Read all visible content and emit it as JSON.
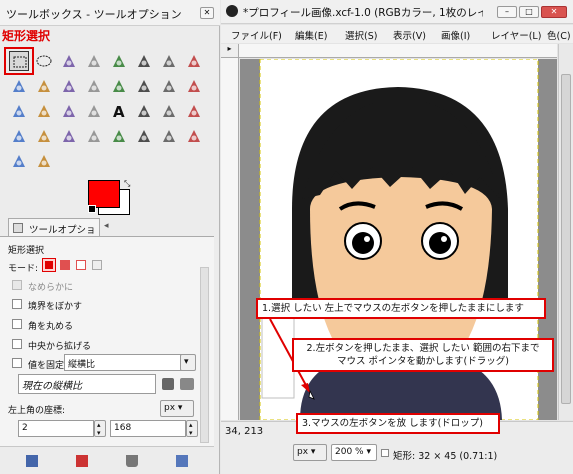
{
  "toolbox": {
    "title": "ツールボックス - ツールオプション",
    "rect_select_label": "矩形選択",
    "options_tab": "ツールオプション",
    "options_title": "矩形選択",
    "mode_label": "モード:",
    "antialias": "なめらかに",
    "feather": "境界をぼかす",
    "rounded": "角を丸める",
    "expand_center": "中央から拡げる",
    "fixed": "値を固定",
    "fixed_value": "縦横比",
    "ratio_field": "現在の縦横比",
    "position_label": "左上角の座標:",
    "unit": "px",
    "x_value": "2",
    "y_value": "168"
  },
  "image_window": {
    "title": "*プロフィール画像.xcf-1.0 (RGBカラー, 1枚のレイ…",
    "menus": [
      "ファイル(F)",
      "編集(E)",
      "選択(S)",
      "表示(V)",
      "画像(I)",
      "レイヤー(L)",
      "色(C)"
    ],
    "status": {
      "coords": "34, 213",
      "unit": "px",
      "zoom": "200 %",
      "info": "矩形: 32 × 45  (0.71:1)"
    }
  },
  "annotations": {
    "step1": "1.選択 したい 左上でマウスの左ボタンを押したままにします",
    "step2_line1": "2.左ボタンを押したまま、選択 したい 範囲の右下まで",
    "step2_line2": "マウス ポインタを動かします(ドラッグ)",
    "step3": "3.マウスの左ボタンを放 します(ドロップ)"
  },
  "colors": {
    "accent": "#e00000",
    "foreground": "#ff0000",
    "background": "#ffffff",
    "skin": "#f5c99b",
    "hair": "#1a1a1a",
    "shirt": "#33354f"
  },
  "icons": [
    "rect-select-icon",
    "ellipse-select-icon",
    "lasso-icon",
    "fuzzy-select-icon",
    "select-by-color-icon",
    "scissors-icon",
    "foreground-select-icon",
    "paths-icon",
    "color-picker-icon",
    "zoom-icon",
    "measure-icon",
    "move-icon",
    "align-icon",
    "crop-icon",
    "rotate-icon",
    "scale-icon",
    "shear-icon",
    "perspective-icon",
    "flip-icon",
    "cage-icon",
    "text-icon",
    "bucket-fill-icon",
    "blend-icon",
    "pencil-icon",
    "paintbrush-icon",
    "eraser-icon",
    "airbrush-icon",
    "ink-icon",
    "clone-icon",
    "heal-icon",
    "perspective-clone-icon",
    "blur-icon",
    "smudge-icon",
    "dodge-burn-icon"
  ]
}
